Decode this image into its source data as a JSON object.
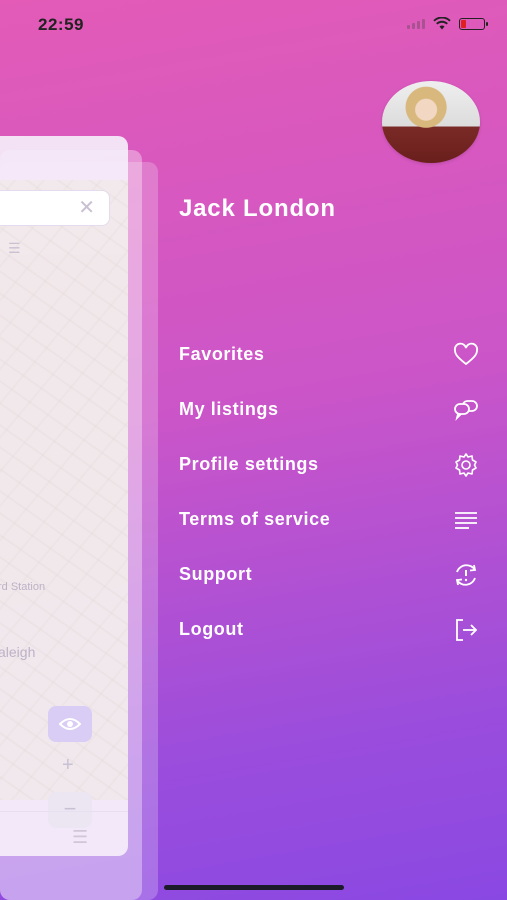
{
  "status_bar": {
    "time": "22:59"
  },
  "profile": {
    "name": "Jack London"
  },
  "menu": {
    "items": [
      {
        "label": "Favorites",
        "icon": "heart-icon"
      },
      {
        "label": "My listings",
        "icon": "chat-bubbles-icon"
      },
      {
        "label": "Profile settings",
        "icon": "gear-icon"
      },
      {
        "label": "Terms of service",
        "icon": "lines-icon"
      },
      {
        "label": "Support",
        "icon": "support-icon"
      },
      {
        "label": "Logout",
        "icon": "logout-icon"
      }
    ]
  },
  "background_screen": {
    "map_labels": [
      "rd Station",
      "aleigh"
    ]
  }
}
